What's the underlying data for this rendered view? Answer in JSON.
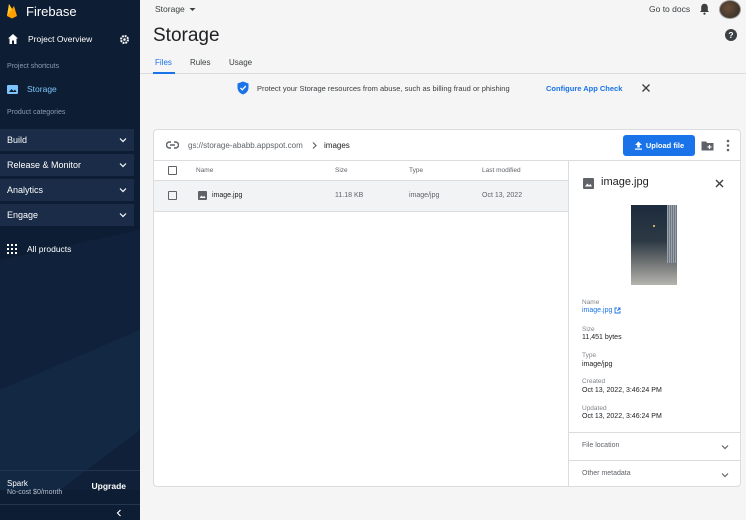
{
  "sidebar": {
    "brand": "Firebase",
    "project_overview": "Project Overview",
    "shortcuts_label": "Project shortcuts",
    "storage_item": "Storage",
    "categories_label": "Product categories",
    "categories": [
      "Build",
      "Release & Monitor",
      "Analytics",
      "Engage"
    ],
    "all_products": "All products",
    "plan_name": "Spark",
    "plan_desc": "No-cost $0/month",
    "upgrade": "Upgrade"
  },
  "topbar": {
    "breadcrumb": "Storage",
    "go_to_docs": "Go to docs"
  },
  "page": {
    "title": "Storage",
    "tabs": [
      "Files",
      "Rules",
      "Usage"
    ],
    "active_tab": "Files"
  },
  "banner": {
    "message": "Protect your Storage resources from abuse, such as billing fraud or phishing",
    "action": "Configure App Check"
  },
  "browser": {
    "bucket": "gs://storage-ababb.appspot.com",
    "folder": "images",
    "upload_label": "Upload file",
    "columns": [
      "Name",
      "Size",
      "Type",
      "Last modified"
    ],
    "rows": [
      {
        "name": "image.jpg",
        "size": "11.18 KB",
        "type": "image/jpg",
        "modified": "Oct 13, 2022"
      }
    ]
  },
  "details": {
    "title": "image.jpg",
    "fields": [
      {
        "label": "Name",
        "value": "image.jpg"
      },
      {
        "label": "Size",
        "value": "11,451 bytes"
      },
      {
        "label": "Type",
        "value": "image/jpg"
      },
      {
        "label": "Created",
        "value": "Oct 13, 2022, 3:46:24 PM"
      },
      {
        "label": "Updated",
        "value": "Oct 13, 2022, 3:46:24 PM"
      }
    ],
    "sections": [
      "File location",
      "Other metadata"
    ]
  },
  "colors": {
    "sidebar_bg": "#0d1d33",
    "accent": "#1a73e8",
    "storage_active": "#7cc4fa"
  },
  "icons": [
    "firebase-flame-icon",
    "home-icon",
    "gear-icon",
    "image-icon",
    "chevron-down-icon",
    "apps-grid-icon",
    "chevron-left-icon",
    "bell-icon",
    "help-icon",
    "shield-icon",
    "close-icon",
    "link-icon",
    "chevron-right-icon",
    "upload-icon",
    "new-folder-icon",
    "more-vert-icon",
    "open-in-new-icon"
  ]
}
